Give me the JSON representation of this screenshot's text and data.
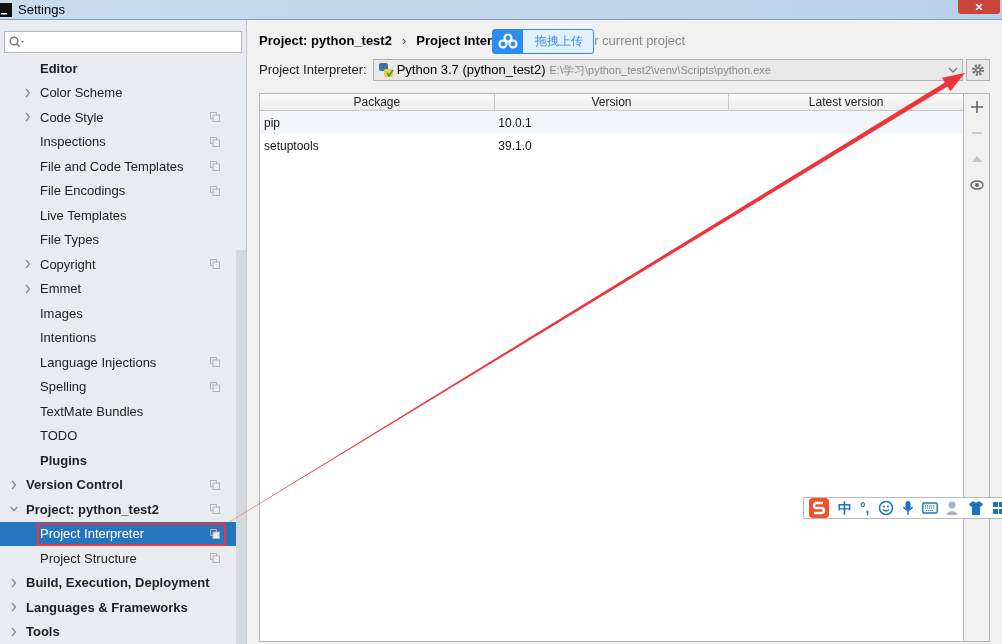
{
  "window": {
    "title": "Settings"
  },
  "sidebar": {
    "items": [
      {
        "label": "Editor",
        "kind": "section",
        "selected": false,
        "children": [
          {
            "label": "Color Scheme",
            "expanded": false,
            "project_level": false,
            "selected": false
          },
          {
            "label": "Code Style",
            "expanded": false,
            "project_level": true,
            "selected": false
          },
          {
            "label": "Inspections",
            "project_level": true,
            "selected": false
          },
          {
            "label": "File and Code Templates",
            "project_level": true,
            "selected": false
          },
          {
            "label": "File Encodings",
            "project_level": true,
            "selected": false
          },
          {
            "label": "Live Templates",
            "project_level": false,
            "selected": false
          },
          {
            "label": "File Types",
            "project_level": false,
            "selected": false
          },
          {
            "label": "Copyright",
            "expanded": false,
            "project_level": true,
            "selected": false
          },
          {
            "label": "Emmet",
            "expanded": false,
            "project_level": false,
            "selected": false
          },
          {
            "label": "Images",
            "project_level": false,
            "selected": false
          },
          {
            "label": "Intentions",
            "project_level": false,
            "selected": false
          },
          {
            "label": "Language Injections",
            "project_level": true,
            "selected": false
          },
          {
            "label": "Spelling",
            "project_level": true,
            "selected": false
          },
          {
            "label": "TextMate Bundles",
            "project_level": false,
            "selected": false
          },
          {
            "label": "TODO",
            "project_level": false,
            "selected": false
          }
        ]
      },
      {
        "label": "Plugins",
        "kind": "section",
        "selected": false
      },
      {
        "label": "Version Control",
        "kind": "group",
        "expanded": false,
        "project_level": true,
        "selected": false
      },
      {
        "label": "Project: python_test2",
        "kind": "group",
        "expanded": true,
        "project_level": true,
        "selected": false,
        "children": [
          {
            "label": "Project Interpreter",
            "project_level": true,
            "selected": true
          },
          {
            "label": "Project Structure",
            "project_level": true,
            "selected": false
          }
        ]
      },
      {
        "label": "Build, Execution, Deployment",
        "kind": "group",
        "expanded": false,
        "project_level": false,
        "selected": false
      },
      {
        "label": "Languages & Frameworks",
        "kind": "group",
        "expanded": false,
        "project_level": false,
        "selected": false
      },
      {
        "label": "Tools",
        "kind": "group",
        "expanded": false,
        "project_level": false,
        "selected": false
      }
    ]
  },
  "breadcrumb": {
    "parent": "Project: python_test2",
    "separator": "›",
    "current": "Project Inter",
    "hint": "r current project"
  },
  "interpreter": {
    "label": "Project Interpreter:",
    "name": "Python 3.7 (python_test2)",
    "path": "E:\\学习\\python_test2\\venv\\Scripts\\python.exe"
  },
  "table": {
    "columns": [
      "Package",
      "Version",
      "Latest version"
    ],
    "rows": [
      {
        "cells": [
          "pip",
          "10.0.1",
          ""
        ]
      },
      {
        "cells": [
          "setuptools",
          "39.1.0",
          ""
        ]
      }
    ]
  },
  "table_toolbar": [
    {
      "kind": "add",
      "disabled": false
    },
    {
      "kind": "remove",
      "disabled": true
    },
    {
      "kind": "upgrade",
      "disabled": true
    },
    {
      "kind": "show",
      "disabled": false
    }
  ],
  "upload_button": {
    "label": "拖拽上传"
  },
  "ime_toolbar": {
    "mode": "中",
    "punctuation": "°,"
  }
}
